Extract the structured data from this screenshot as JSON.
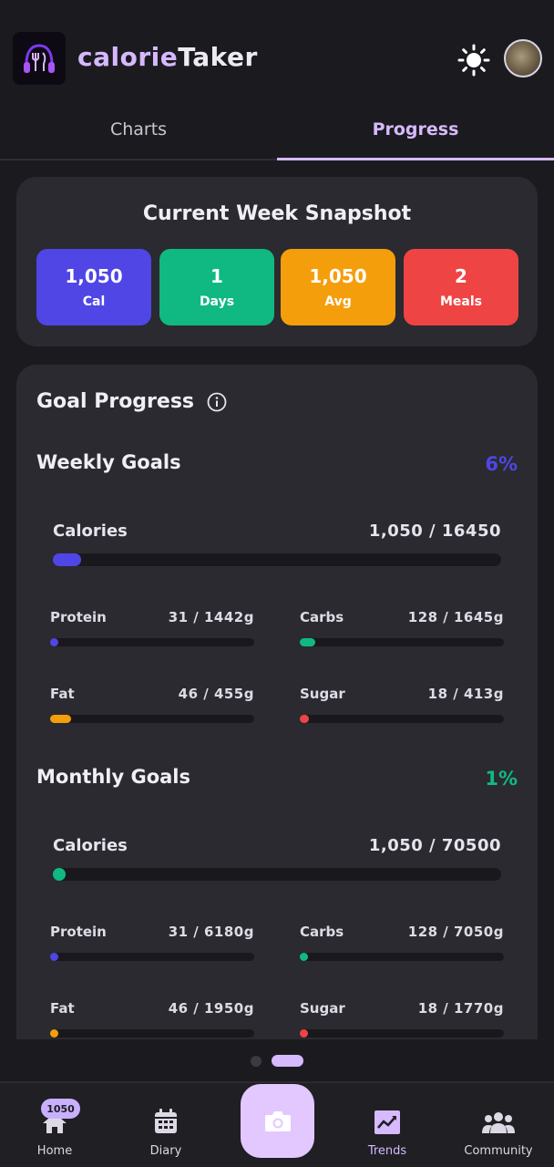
{
  "app": {
    "title_part1": "calorie",
    "title_part2": "Taker",
    "logo_icon": "headphones-fork-knife-logo",
    "theme_icon": "sun-icon"
  },
  "tabs": [
    {
      "label": "Charts",
      "active": false
    },
    {
      "label": "Progress",
      "active": true
    }
  ],
  "snapshot": {
    "title": "Current Week Snapshot",
    "stats": [
      {
        "value": "1,050",
        "label": "Cal",
        "color": "#4f46e5"
      },
      {
        "value": "1",
        "label": "Days",
        "color": "#10b981"
      },
      {
        "value": "1,050",
        "label": "Avg",
        "color": "#f59e0b"
      },
      {
        "value": "2",
        "label": "Meals",
        "color": "#ef4444"
      }
    ]
  },
  "goals": {
    "title": "Goal Progress",
    "weekly": {
      "title": "Weekly Goals",
      "percent": "6%",
      "percent_color": "#4f46e5",
      "calories": {
        "label": "Calories",
        "value": "1,050 / 16450",
        "fraction": 0.064,
        "color": "#4f46e5"
      },
      "protein": {
        "label": "Protein",
        "value": "31 / 1442g",
        "fraction": 0.021,
        "color": "#4f46e5"
      },
      "carbs": {
        "label": "Carbs",
        "value": "128 / 1645g",
        "fraction": 0.078,
        "color": "#10b981"
      },
      "fat": {
        "label": "Fat",
        "value": "46 / 455g",
        "fraction": 0.101,
        "color": "#f59e0b"
      },
      "sugar": {
        "label": "Sugar",
        "value": "18 / 413g",
        "fraction": 0.044,
        "color": "#ef4444"
      }
    },
    "monthly": {
      "title": "Monthly Goals",
      "percent": "1%",
      "percent_color": "#10b981",
      "calories": {
        "label": "Calories",
        "value": "1,050 / 70500",
        "fraction": 0.015,
        "color": "#10b981"
      },
      "protein": {
        "label": "Protein",
        "value": "31 / 6180g",
        "fraction": 0.005,
        "color": "#4f46e5"
      },
      "carbs": {
        "label": "Carbs",
        "value": "128 / 7050g",
        "fraction": 0.018,
        "color": "#10b981"
      },
      "fat": {
        "label": "Fat",
        "value": "46 / 1950g",
        "fraction": 0.024,
        "color": "#f59e0b"
      },
      "sugar": {
        "label": "Sugar",
        "value": "18 / 1770g",
        "fraction": 0.01,
        "color": "#ef4444"
      }
    }
  },
  "nav": {
    "badge": "1050",
    "items": [
      {
        "label": "Home",
        "icon": "home-icon"
      },
      {
        "label": "Diary",
        "icon": "calendar-icon"
      },
      {
        "label": "Trends",
        "icon": "trends-icon",
        "active": true
      },
      {
        "label": "Community",
        "icon": "community-icon"
      }
    ],
    "camera_icon": "camera-icon"
  }
}
